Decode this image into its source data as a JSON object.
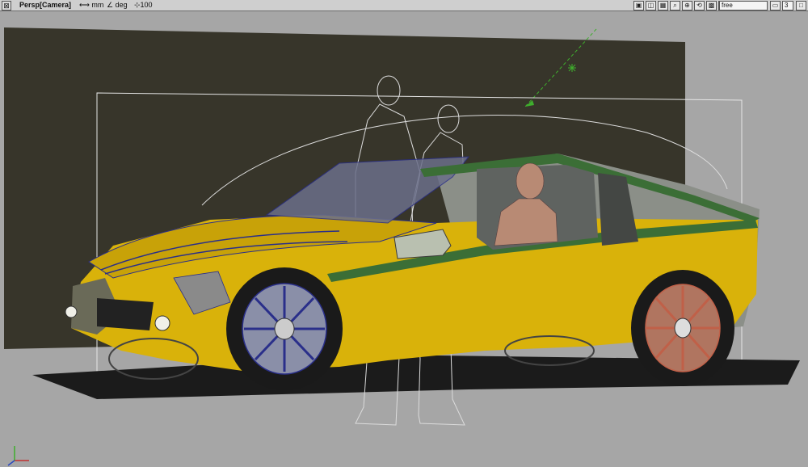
{
  "window": {
    "close_glyph": "⊠",
    "title": "Persp[Camera]",
    "linear_unit": "⟷ mm",
    "angle_unit": "∠ deg",
    "zoom_label": "⊹100"
  },
  "toolbar": {
    "icons": [
      "render-icon",
      "lock-icon",
      "grid-icon",
      "zoom-icon",
      "magnify-icon",
      "tumble-icon",
      "fit-icon",
      "track-icon"
    ],
    "camera_mode": "free",
    "pane_count": "3"
  },
  "colors": {
    "background": "#a6a6a6",
    "backdrop": "#37352a",
    "car_body": "#d9b20a",
    "car_shadow": "#1b1b1b",
    "stripe": "#3b6e36",
    "wire_blue": "#2a2f8a",
    "mannequin": "#b88a74",
    "rear_wheel": "#c06048",
    "light_vector": "#3fae2d"
  }
}
